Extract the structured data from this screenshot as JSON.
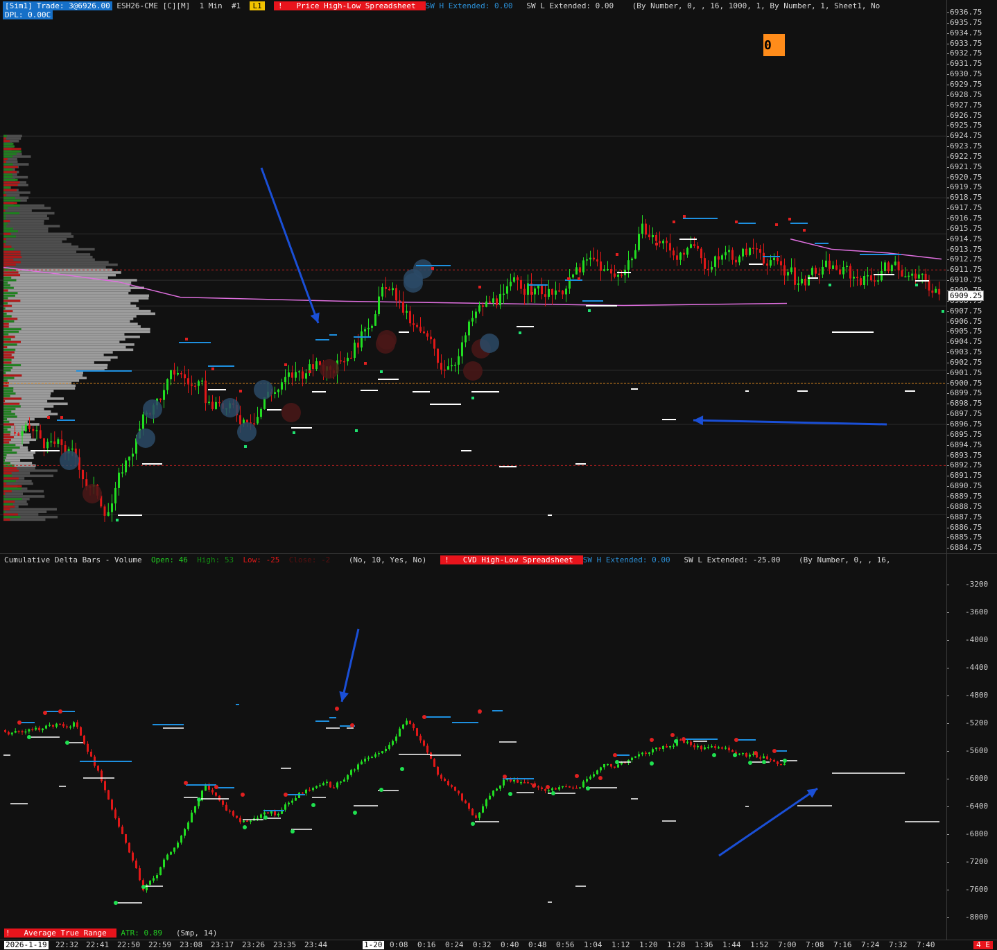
{
  "price_header": {
    "sim": "[Sim1]",
    "trade": "Trade: 3@6926.00",
    "symbol": "ESH26-CME [C][M]",
    "interval": "1 Min",
    "instance": "#1",
    "level": "L1",
    "study_alert": "!",
    "study_name": "Price High-Low Spreadsheet",
    "sw_h_label": "SW H Extended:",
    "sw_h_value": "0.00",
    "sw_l": "SW L Extended: 0.00",
    "params": "(By Number, 0, , 16, 1000, 1, By Number, 1, Sheet1, No",
    "dpl": "DPL: 0.00C",
    "order_badge": "0"
  },
  "price_axis": {
    "labels": [
      "6936.75",
      "6935.75",
      "6934.75",
      "6933.75",
      "6932.75",
      "6931.75",
      "6930.75",
      "6929.75",
      "6928.75",
      "6927.75",
      "6926.75",
      "6925.75",
      "6924.75",
      "6923.75",
      "6922.75",
      "6921.75",
      "6920.75",
      "6919.75",
      "6918.75",
      "6917.75",
      "6916.75",
      "6915.75",
      "6914.75",
      "6913.75",
      "6912.75",
      "6911.75",
      "6910.75",
      "6909.75",
      "6908.75",
      "6907.75",
      "6906.75",
      "6905.75",
      "6904.75",
      "6903.75",
      "6902.75",
      "6901.75",
      "6900.75",
      "6899.75",
      "6898.75",
      "6897.75",
      "6896.75",
      "6895.75",
      "6894.75",
      "6893.75",
      "6892.75",
      "6891.75",
      "6890.75",
      "6889.75",
      "6888.75",
      "6887.75",
      "6886.75",
      "6885.75",
      "6884.75"
    ],
    "current_price": "6909.25"
  },
  "cvd_header": {
    "title": "Cumulative Delta Bars - Volume",
    "open_label": "Open:",
    "open_value": "46",
    "high_label": "High:",
    "high_value": "53",
    "low_label": "Low:",
    "low_value": "-25",
    "close_label": "Close:",
    "close_value": "-2",
    "params": "(No, 10, Yes, No)",
    "study_alert": "!",
    "study_name": "CVD High-Low Spreadsheet",
    "sw_h_label": "SW H Extended:",
    "sw_h_value": "0.00",
    "sw_l": "SW L Extended: -25.00",
    "params2": "(By Number, 0, , 16,"
  },
  "cvd_axis": {
    "labels": [
      "-3200",
      "-3600",
      "-4000",
      "-4400",
      "-4800",
      "-5200",
      "-5600",
      "-6000",
      "-6400",
      "-6800",
      "-7200",
      "-7600",
      "-8000"
    ]
  },
  "atr_header": {
    "study_alert": "!",
    "study_name": "Average True Range",
    "atr_label": "ATR:",
    "atr_value": "0.89",
    "params": "(Smp, 14)"
  },
  "time_axis": {
    "labels": [
      "2026-1-19",
      "22:32",
      "22:41",
      "22:50",
      "22:59",
      "23:08",
      "23:17",
      "23:26",
      "23:35",
      "23:44",
      "1-20",
      "0:08",
      "0:16",
      "0:24",
      "0:32",
      "0:40",
      "0:48",
      "0:56",
      "1:04",
      "1:12",
      "1:20",
      "1:28",
      "1:36",
      "1:44",
      "1:52",
      "7:00",
      "7:08",
      "7:16",
      "7:24",
      "7:32",
      "7:40"
    ],
    "corner_badge": "4 E"
  },
  "colors": {
    "background": "#111111",
    "up_candle": "#22dd22",
    "down_candle": "#e01818",
    "swing_high_line": "#1e90e0",
    "swing_low_line": "#ffffff",
    "vwap_line": "#e070e0",
    "arrow": "#1a4fd6",
    "volume_profile": "#9a9a9a",
    "red_dashed": "#c02020",
    "orange_dashed": "#e08a20"
  },
  "chart_data": [
    {
      "type": "candlestick",
      "title": "ESH26-CME 1 Min",
      "ylim": [
        6884.75,
        6936.75
      ],
      "current_price": 6909.25,
      "x": [
        "22:32",
        "22:41",
        "22:50",
        "22:59",
        "23:08",
        "23:17",
        "23:26",
        "23:35",
        "23:44",
        "0:00",
        "0:08",
        "0:16",
        "0:24",
        "0:32",
        "0:40",
        "0:48",
        "0:56",
        "1:04",
        "1:12",
        "1:20",
        "1:28",
        "1:36",
        "1:44",
        "1:52",
        "7:00",
        "7:08",
        "7:16",
        "7:24",
        "7:32",
        "7:40"
      ],
      "close": [
        6895.5,
        6893.0,
        6888.5,
        6897.0,
        6902.0,
        6899.5,
        6897.5,
        6900.0,
        6901.5,
        6902.5,
        6905.0,
        6910.5,
        6906.0,
        6902.5,
        6907.5,
        6909.0,
        6910.0,
        6909.0,
        6912.5,
        6911.0,
        6915.5,
        6913.5,
        6912.5,
        6913.5,
        6914.0,
        6911.0,
        6911.5,
        6911.5,
        6912.0,
        6909.25
      ]
    },
    {
      "type": "candlestick",
      "title": "Cumulative Delta Bars - Volume",
      "ylim": [
        -8000,
        -3200
      ],
      "x": [
        "22:32",
        "22:41",
        "22:50",
        "22:59",
        "23:08",
        "23:17",
        "23:26",
        "23:35",
        "23:44",
        "0:00",
        "0:08",
        "0:16",
        "0:24",
        "0:32",
        "0:40",
        "0:48",
        "0:56",
        "1:04",
        "1:12",
        "1:20",
        "1:28",
        "1:36",
        "1:44",
        "1:52",
        "7:00"
      ],
      "close": [
        -5300,
        -5200,
        -6000,
        -7600,
        -6900,
        -6100,
        -6600,
        -6500,
        -6200,
        -6100,
        -5700,
        -5150,
        -6000,
        -6600,
        -6000,
        -6100,
        -6100,
        -6000,
        -5800,
        -5600,
        -5450,
        -5550,
        -5600,
        -5700,
        -5750
      ]
    }
  ]
}
